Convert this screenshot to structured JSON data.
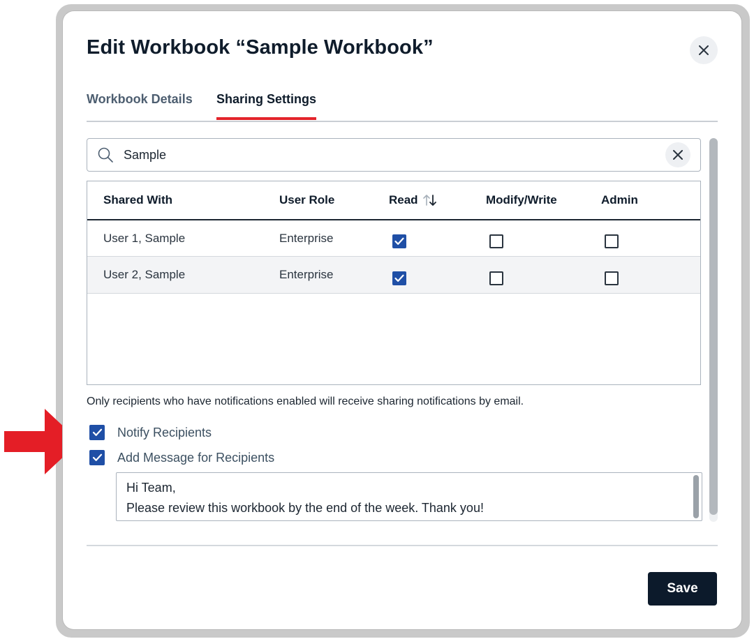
{
  "dialog": {
    "title": "Edit Workbook “Sample Workbook”",
    "close_icon": "close-icon"
  },
  "tabs": [
    {
      "label": "Workbook Details",
      "active": false
    },
    {
      "label": "Sharing Settings",
      "active": true
    }
  ],
  "search": {
    "value": "Sample",
    "icon": "search-icon",
    "clear_icon": "close-icon"
  },
  "table": {
    "headers": [
      "Shared With",
      "User Role",
      "Read",
      "Modify/Write",
      "Admin"
    ],
    "sort_icon": "sort-icon",
    "rows": [
      {
        "shared_with": "User 1, Sample",
        "user_role": "Enterprise",
        "read": true,
        "modify": false,
        "admin": false
      },
      {
        "shared_with": "User 2, Sample",
        "user_role": "Enterprise",
        "read": true,
        "modify": false,
        "admin": false
      }
    ]
  },
  "notice": "Only recipients who have notifications enabled will receive sharing notifications by email.",
  "options": [
    {
      "label": "Notify Recipients",
      "checked": true
    },
    {
      "label": "Add Message for Recipients",
      "checked": true
    }
  ],
  "message": {
    "lines": [
      "Hi Team,",
      "Please review this workbook by the end of the week. Thank you!"
    ]
  },
  "save_label": "Save",
  "colors": {
    "accent": "#e3242b",
    "checkbox": "#1f4fa6",
    "primary_button": "#0c1a2b",
    "annotation_arrow": "#e41e26"
  }
}
